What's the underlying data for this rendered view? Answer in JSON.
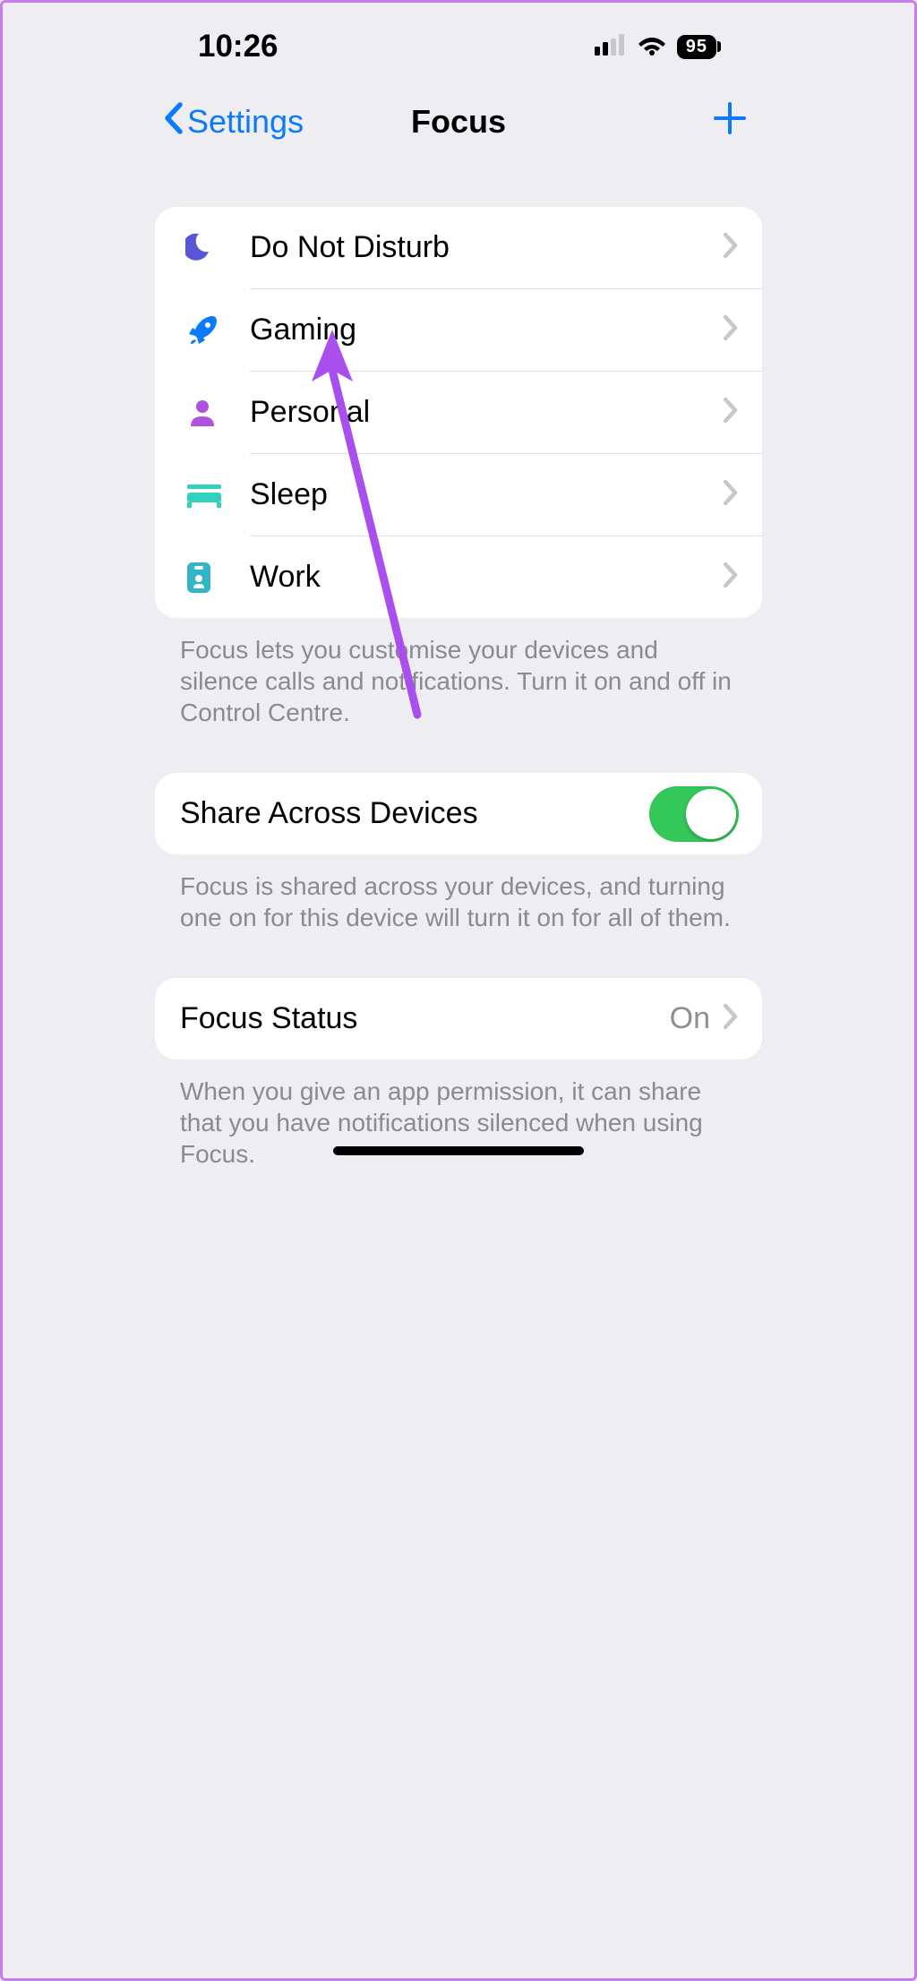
{
  "status": {
    "time": "10:26",
    "battery": "95"
  },
  "nav": {
    "back_label": "Settings",
    "title": "Focus"
  },
  "focus_list": [
    {
      "label": "Do Not Disturb",
      "icon": "moon",
      "color": "#5856d6"
    },
    {
      "label": "Gaming",
      "icon": "rocket",
      "color": "#0a7aff"
    },
    {
      "label": "Personal",
      "icon": "person",
      "color": "#af52de"
    },
    {
      "label": "Sleep",
      "icon": "bed",
      "color": "#30d1bd"
    },
    {
      "label": "Work",
      "icon": "badge",
      "color": "#30b6c7"
    }
  ],
  "footer1": "Focus lets you customise your devices and silence calls and notifications. Turn it on and off in Control Centre.",
  "share": {
    "label": "Share Across Devices",
    "on": true
  },
  "footer2": "Focus is shared across your devices, and turning one on for this device will turn it on for all of them.",
  "status_row": {
    "label": "Focus Status",
    "value": "On"
  },
  "footer3": "When you give an app permission, it can share that you have notifications silenced when using Focus."
}
